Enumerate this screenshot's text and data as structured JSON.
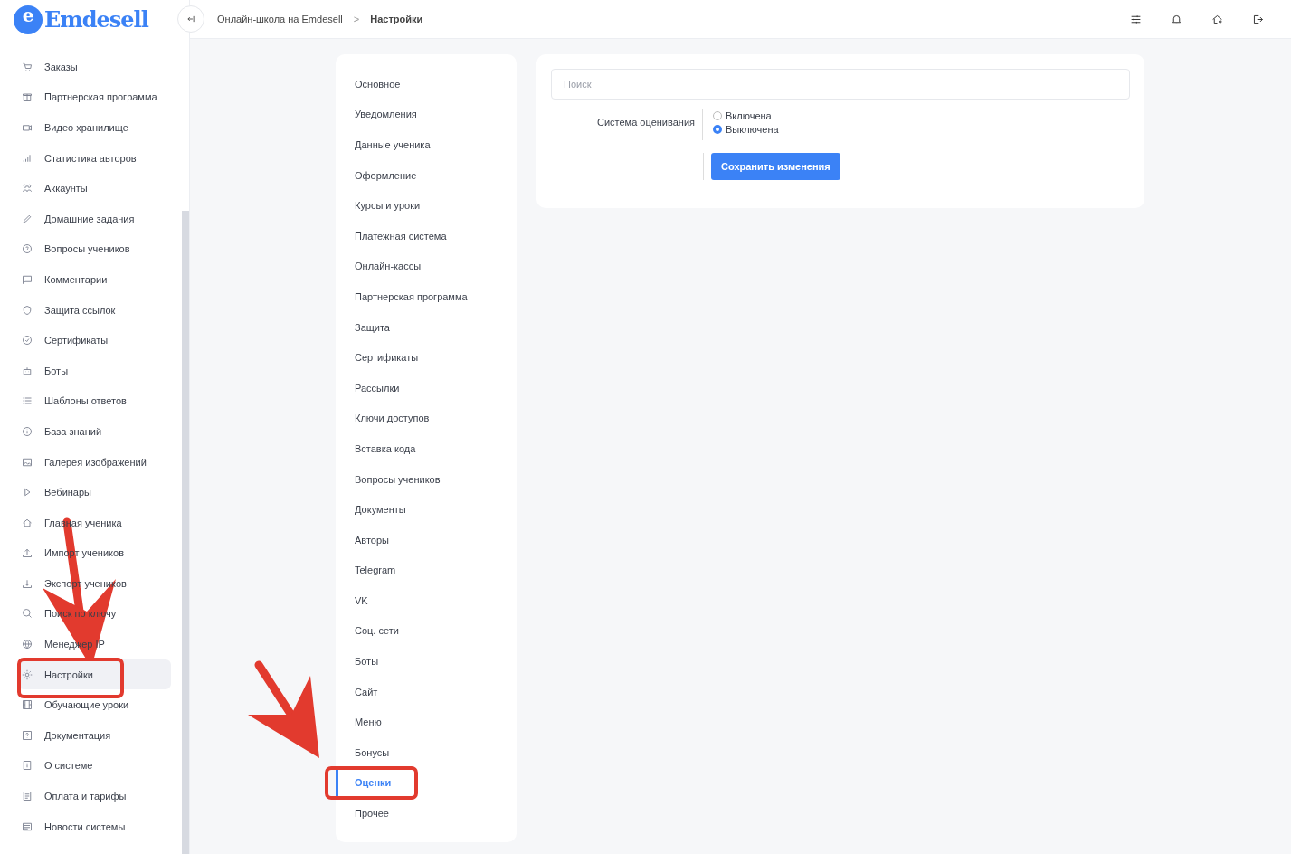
{
  "logo": {
    "letter": "e",
    "name": "Emdesell"
  },
  "sidebar": {
    "items": [
      {
        "label": "Заказы",
        "selected": false
      },
      {
        "label": "Партнерская программа",
        "selected": false
      },
      {
        "label": "Видео хранилище",
        "selected": false
      },
      {
        "label": "Статистика авторов",
        "selected": false
      },
      {
        "label": "Аккаунты",
        "selected": false
      },
      {
        "label": "Домашние задания",
        "selected": false
      },
      {
        "label": "Вопросы учеников",
        "selected": false
      },
      {
        "label": "Комментарии",
        "selected": false
      },
      {
        "label": "Защита ссылок",
        "selected": false
      },
      {
        "label": "Сертификаты",
        "selected": false
      },
      {
        "label": "Боты",
        "selected": false
      },
      {
        "label": "Шаблоны ответов",
        "selected": false
      },
      {
        "label": "База знаний",
        "selected": false
      },
      {
        "label": "Галерея изображений",
        "selected": false
      },
      {
        "label": "Вебинары",
        "selected": false
      },
      {
        "label": "Главная ученика",
        "selected": false
      },
      {
        "label": "Импорт учеников",
        "selected": false
      },
      {
        "label": "Экспорт учеников",
        "selected": false
      },
      {
        "label": "Поиск по ключу",
        "selected": false
      },
      {
        "label": "Менеджер IP",
        "selected": false
      },
      {
        "label": "Настройки",
        "selected": true
      },
      {
        "label": "Обучающие уроки",
        "selected": false
      },
      {
        "label": "Документация",
        "selected": false
      },
      {
        "label": "О системе",
        "selected": false
      },
      {
        "label": "Оплата и тарифы",
        "selected": false
      },
      {
        "label": "Новости системы",
        "selected": false
      }
    ]
  },
  "breadcrumb": {
    "parent": "Онлайн-школа на Emdesell",
    "separator": ">",
    "current": "Настройки"
  },
  "settings_menu": {
    "items": [
      {
        "label": "Основное",
        "selected": false
      },
      {
        "label": "Уведомления",
        "selected": false
      },
      {
        "label": "Данные ученика",
        "selected": false
      },
      {
        "label": "Оформление",
        "selected": false
      },
      {
        "label": "Курсы и уроки",
        "selected": false
      },
      {
        "label": "Платежная система",
        "selected": false
      },
      {
        "label": "Онлайн-кассы",
        "selected": false
      },
      {
        "label": "Партнерская программа",
        "selected": false
      },
      {
        "label": "Защита",
        "selected": false
      },
      {
        "label": "Сертификаты",
        "selected": false
      },
      {
        "label": "Рассылки",
        "selected": false
      },
      {
        "label": "Ключи доступов",
        "selected": false
      },
      {
        "label": "Вставка кода",
        "selected": false
      },
      {
        "label": "Вопросы учеников",
        "selected": false
      },
      {
        "label": "Документы",
        "selected": false
      },
      {
        "label": "Авторы",
        "selected": false
      },
      {
        "label": "Telegram",
        "selected": false
      },
      {
        "label": "VK",
        "selected": false
      },
      {
        "label": "Соц. сети",
        "selected": false
      },
      {
        "label": "Боты",
        "selected": false
      },
      {
        "label": "Сайт",
        "selected": false
      },
      {
        "label": "Меню",
        "selected": false
      },
      {
        "label": "Бонусы",
        "selected": false
      },
      {
        "label": "Оценки",
        "selected": true
      },
      {
        "label": "Прочее",
        "selected": false
      }
    ]
  },
  "panel": {
    "search": {
      "placeholder": "Поиск"
    },
    "field": {
      "label": "Система оценивания",
      "options": [
        {
          "label": "Включена",
          "selected": false
        },
        {
          "label": "Выключена",
          "selected": true
        }
      ]
    },
    "save_button": "Сохранить изменения"
  }
}
